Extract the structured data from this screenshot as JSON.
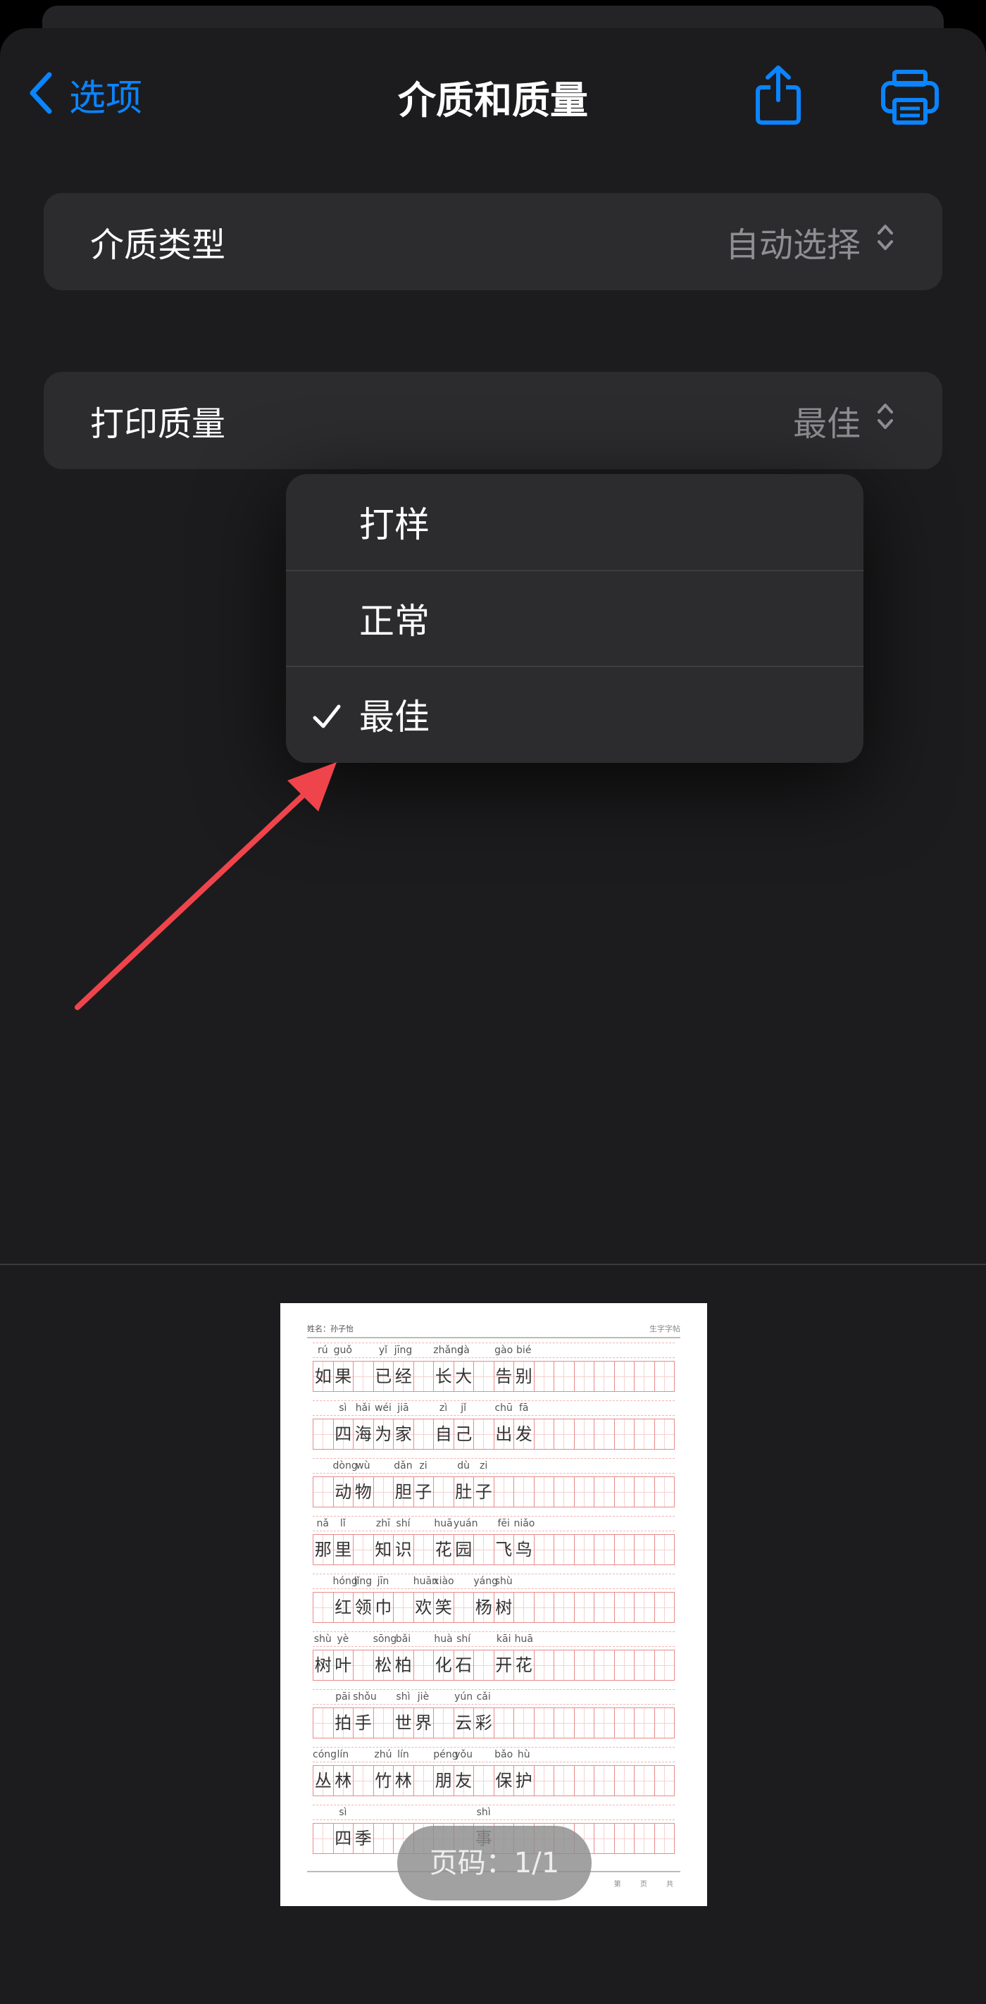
{
  "nav": {
    "back_label": "选项",
    "title": "介质和质量",
    "accent_color": "#0a84ff",
    "icons": {
      "back": "chevron-left-icon",
      "share": "share-icon",
      "print": "printer-icon"
    }
  },
  "settings": {
    "media_type": {
      "label": "介质类型",
      "value": "自动选择"
    },
    "print_quality": {
      "label": "打印质量",
      "value": "最佳"
    }
  },
  "quality_menu": {
    "options": [
      "打样",
      "正常",
      "最佳"
    ],
    "selected": "最佳"
  },
  "preview": {
    "page_indicator": "页码：1/1",
    "paper_label_left": "姓名：孙子怡",
    "paper_label_right": "生字字帖",
    "paper_footer": "第 页 共",
    "rows": [
      {
        "pinyin": [
          "rú",
          "guǒ",
          "",
          "yǐ",
          "jīng",
          "",
          "zhǎng",
          "dà",
          "",
          "gào",
          "bié"
        ],
        "chars": [
          "如",
          "果",
          "",
          "已",
          "经",
          "",
          "长",
          "大",
          "",
          "告",
          "别"
        ]
      },
      {
        "pinyin": [
          "",
          "sì",
          "hǎi",
          "wéi",
          "jiā",
          "",
          "zì",
          "jǐ",
          "",
          "chū",
          "fā"
        ],
        "chars": [
          "",
          "四",
          "海",
          "为",
          "家",
          "",
          "自",
          "己",
          "",
          "出",
          "发"
        ]
      },
      {
        "pinyin": [
          "",
          "dòng",
          "wù",
          "",
          "dǎn",
          "zi",
          "",
          "dù",
          "zi",
          "",
          ""
        ],
        "chars": [
          "",
          "动",
          "物",
          "",
          "胆",
          "子",
          "",
          "肚",
          "子",
          "",
          ""
        ]
      },
      {
        "pinyin": [
          "nǎ",
          "lǐ",
          "",
          "zhī",
          "shí",
          "",
          "huā",
          "yuán",
          "",
          "fēi",
          "niǎo"
        ],
        "chars": [
          "那",
          "里",
          "",
          "知",
          "识",
          "",
          "花",
          "园",
          "",
          "飞",
          "鸟"
        ]
      },
      {
        "pinyin": [
          "",
          "hóng",
          "lǐng",
          "jīn",
          "",
          "huān",
          "xiào",
          "",
          "yáng",
          "shù",
          ""
        ],
        "chars": [
          "",
          "红",
          "领",
          "巾",
          "",
          "欢",
          "笑",
          "",
          "杨",
          "树",
          ""
        ]
      },
      {
        "pinyin": [
          "shù",
          "yè",
          "",
          "sōng",
          "bǎi",
          "",
          "huà",
          "shí",
          "",
          "kāi",
          "huā"
        ],
        "chars": [
          "树",
          "叶",
          "",
          "松",
          "柏",
          "",
          "化",
          "石",
          "",
          "开",
          "花"
        ]
      },
      {
        "pinyin": [
          "",
          "pāi",
          "shǒu",
          "",
          "shì",
          "jiè",
          "",
          "yún",
          "cǎi",
          "",
          ""
        ],
        "chars": [
          "",
          "拍",
          "手",
          "",
          "世",
          "界",
          "",
          "云",
          "彩",
          "",
          ""
        ]
      },
      {
        "pinyin": [
          "cóng",
          "lín",
          "",
          "zhú",
          "lín",
          "",
          "péng",
          "yǒu",
          "",
          "bǎo",
          "hù"
        ],
        "chars": [
          "丛",
          "林",
          "",
          "竹",
          "林",
          "",
          "朋",
          "友",
          "",
          "保",
          "护"
        ]
      },
      {
        "pinyin": [
          "",
          "sì",
          "",
          "",
          "",
          "",
          "",
          "",
          "shì",
          "",
          ""
        ],
        "chars": [
          "",
          "四",
          "季",
          "",
          "",
          "",
          "",
          "",
          "事",
          "",
          ""
        ]
      }
    ]
  }
}
